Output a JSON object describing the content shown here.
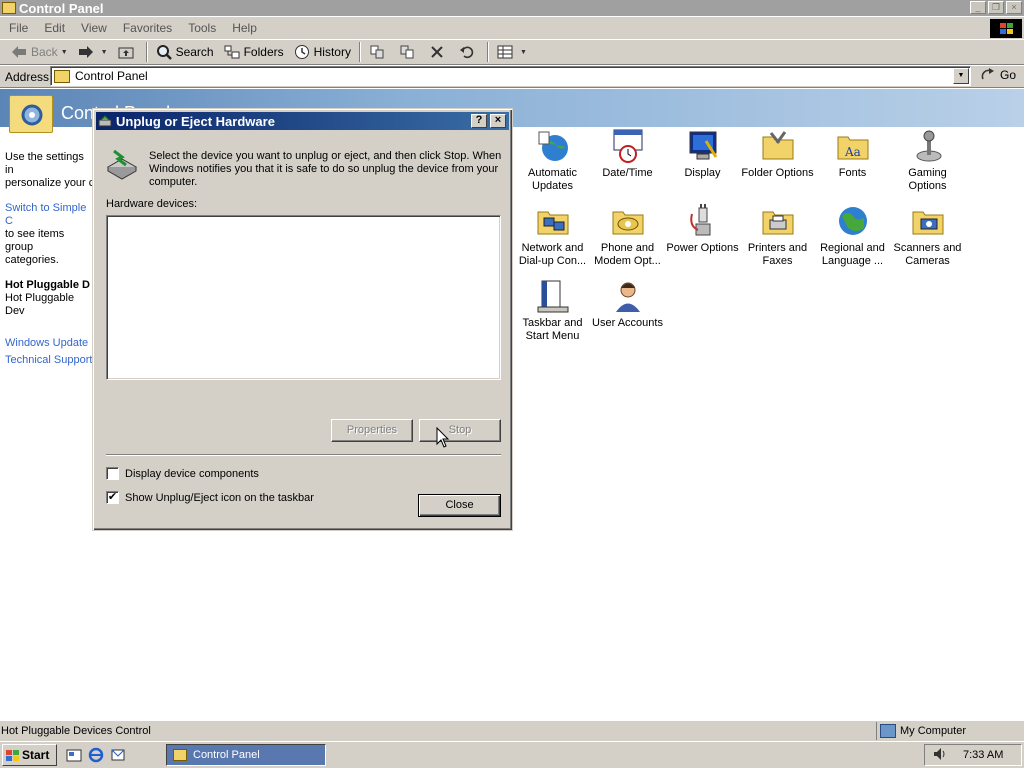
{
  "window": {
    "title": "Control Panel",
    "controls": {
      "minimize": "_",
      "restore": "❐",
      "close": "×"
    }
  },
  "menu": {
    "items": [
      "File",
      "Edit",
      "View",
      "Favorites",
      "Tools",
      "Help"
    ]
  },
  "toolbar": {
    "back": "Back",
    "search": "Search",
    "folders": "Folders",
    "history": "History"
  },
  "address": {
    "label": "Address",
    "value": "Control Panel",
    "go": "Go"
  },
  "content": {
    "banner_title": "Control Panel",
    "left_pane": {
      "intro_line1": "Use the settings in",
      "intro_line2": "personalize your c",
      "switch_link": "Switch to Simple C",
      "switch_rest1": "to see items group",
      "switch_rest2": "categories.",
      "selected_title": "Hot Pluggable D",
      "selected_desc": "Hot Pluggable Dev",
      "link_windows_update": "Windows Update",
      "link_tech_support": "Technical Support"
    },
    "items": [
      {
        "label": "Automatic Updates",
        "icon": "globe-update-icon"
      },
      {
        "label": "Date/Time",
        "icon": "calendar-clock-icon"
      },
      {
        "label": "Display",
        "icon": "monitor-icon"
      },
      {
        "label": "Folder Options",
        "icon": "folder-options-icon"
      },
      {
        "label": "Fonts",
        "icon": "fonts-folder-icon"
      },
      {
        "label": "Gaming Options",
        "icon": "joystick-icon"
      },
      {
        "label": "Network and Dial-up Con...",
        "icon": "network-icon"
      },
      {
        "label": "Phone and Modem Opt...",
        "icon": "phone-icon"
      },
      {
        "label": "Power Options",
        "icon": "power-plug-icon"
      },
      {
        "label": "Printers and Faxes",
        "icon": "printer-folder-icon"
      },
      {
        "label": "Regional and Language ...",
        "icon": "globe-icon"
      },
      {
        "label": "Scanners and Cameras",
        "icon": "scanner-camera-icon"
      },
      {
        "label": "Taskbar and Start Menu",
        "icon": "taskbar-icon"
      },
      {
        "label": "User Accounts",
        "icon": "user-icon"
      }
    ]
  },
  "dialog": {
    "title": "Unplug or Eject Hardware",
    "help": "?",
    "close_x": "×",
    "instructions": "Select the device you want to unplug or eject, and then click Stop. When Windows notifies you that it is safe to do so unplug the device from your computer.",
    "list_label": "Hardware devices:",
    "properties_button": "Properties",
    "stop_button": "Stop",
    "display_components_label": "Display device components",
    "show_icon_label": "Show Unplug/Eject icon on the taskbar",
    "close_button": "Close",
    "display_components_checked": false,
    "show_icon_checked": true,
    "check_mark": "✔"
  },
  "statusbar": {
    "left": "Hot Pluggable Devices Control",
    "right": "My Computer"
  },
  "taskbar": {
    "start": "Start",
    "task": "Control Panel",
    "clock": "7:33 AM"
  },
  "colors": {
    "title_active": "#0a246a",
    "title_inactive": "#a0a0a0",
    "taskbar_task": "#5a78b0",
    "link": "#3366cc",
    "face": "#d4d0c8"
  }
}
